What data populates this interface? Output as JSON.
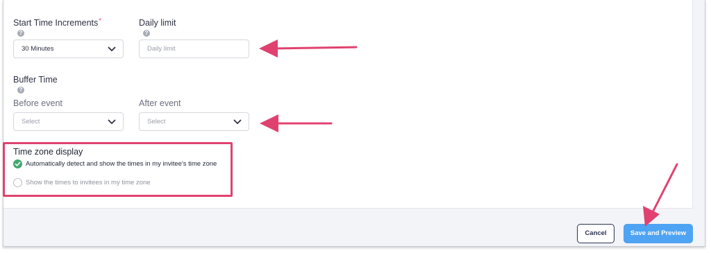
{
  "form": {
    "start_time_increments": {
      "label": "Start Time Increments",
      "required_marker": "*",
      "help_icon": "question-icon",
      "value": "30 Minutes"
    },
    "daily_limit": {
      "label": "Daily limit",
      "help_icon": "question-icon",
      "placeholder": "Daily limit"
    },
    "buffer_time": {
      "label": "Buffer Time",
      "help_icon": "question-icon",
      "before": {
        "label": "Before event",
        "placeholder": "Select"
      },
      "after": {
        "label": "After event",
        "placeholder": "Select"
      }
    },
    "time_zone_display": {
      "label": "Time zone display",
      "options": [
        {
          "label": "Automatically detect and show the times in my invitee's time zone",
          "selected": true
        },
        {
          "label": "Show the times to invitees in my time zone",
          "selected": false
        }
      ]
    }
  },
  "footer": {
    "cancel_label": "Cancel",
    "save_label": "Save and Preview"
  },
  "colors": {
    "annotation": "#e0426f",
    "primary": "#4fa3f3",
    "selected_radio": "#44a871"
  }
}
